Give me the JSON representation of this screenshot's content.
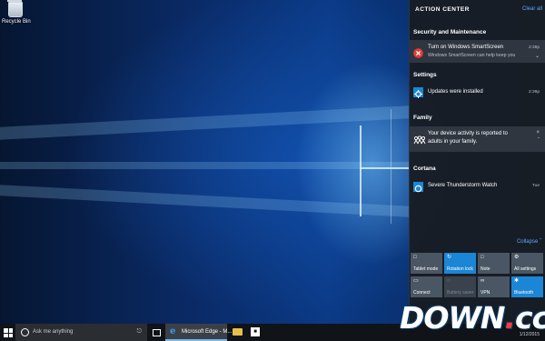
{
  "desktop": {
    "recycle_bin_label": "Recycle Bin"
  },
  "action_center": {
    "title": "ACTION CENTER",
    "clear_all": "Clear all",
    "groups": {
      "security": "Security and Maintenance",
      "settings": "Settings",
      "family": "Family",
      "cortana": "Cortana"
    },
    "notifications": {
      "smartscreen": {
        "title": "Turn on Windows SmartScreen",
        "body": "Windows SmartScreen can help keep you",
        "time": "2:39p"
      },
      "updates": {
        "title": "Updates were installed",
        "time": "2:39p"
      },
      "family": {
        "line1": "Your device activity is reported to",
        "line2": "adults in your family."
      },
      "cortana": {
        "title": "Severe Thunderstorm Watch",
        "time": "Tue"
      }
    },
    "collapse_label": "Collapse",
    "quick_actions": [
      {
        "label": "Tablet mode",
        "state": "off"
      },
      {
        "label": "Rotation lock",
        "state": "on"
      },
      {
        "label": "Note",
        "state": "off"
      },
      {
        "label": "All settings",
        "state": "off"
      },
      {
        "label": "Connect",
        "state": "off"
      },
      {
        "label": "Battery saver",
        "state": "disabled"
      },
      {
        "label": "VPN",
        "state": "off"
      },
      {
        "label": "Bluetooth",
        "state": "on"
      }
    ]
  },
  "taskbar": {
    "search_placeholder": "Ask me anything",
    "edge_label": "Microsoft Edge - M...",
    "date": "1/12/2015"
  },
  "watermark": {
    "text": "DOWN",
    "dot": ".",
    "suffix": "cc"
  },
  "colors": {
    "accent": "#1b86d6",
    "link": "#5ca8ff",
    "tile": "#4a5663",
    "panel": "#181d24"
  }
}
